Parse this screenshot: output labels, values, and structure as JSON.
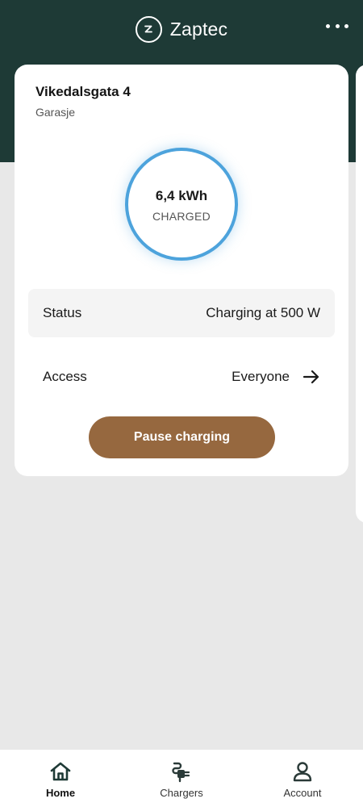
{
  "app": {
    "brand": "Zaptec"
  },
  "charger": {
    "name": "Vikedalsgata 4",
    "location": "Garasje",
    "energy": "6,4 kWh",
    "energy_caption": "CHARGED",
    "status_label": "Status",
    "status_value": "Charging at 500 W",
    "access_label": "Access",
    "access_value": "Everyone",
    "action_label": "Pause charging"
  },
  "nav": {
    "items": [
      {
        "label": "Home",
        "icon": "home-icon",
        "active": true
      },
      {
        "label": "Chargers",
        "icon": "charger-plug-icon",
        "active": false
      },
      {
        "label": "Account",
        "icon": "person-icon",
        "active": false
      }
    ]
  },
  "colors": {
    "header": "#1e3a36",
    "ring": "#4da3dc",
    "button": "#96683f",
    "background": "#e8e8e8"
  }
}
